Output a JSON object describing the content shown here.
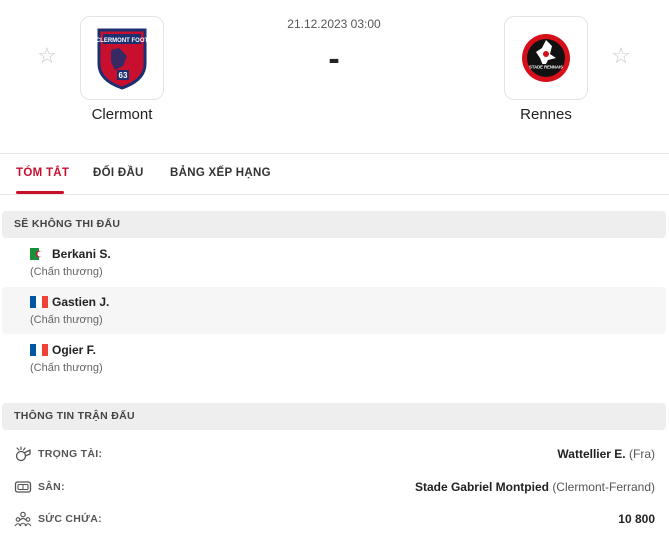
{
  "match": {
    "date": "21.12.2023 03:00",
    "score": "-",
    "home": {
      "name": "Clermont",
      "crest_text": "CLERMONT FOOT",
      "crest_number": "63"
    },
    "away": {
      "name": "Rennes",
      "crest_text": "STADE RENNAIS"
    }
  },
  "tabs": [
    {
      "label": "TÓM TẮT",
      "active": true
    },
    {
      "label": "ĐỐI ĐẦU",
      "active": false
    },
    {
      "label": "BẢNG XẾP HẠNG",
      "active": false
    }
  ],
  "missing": {
    "title": "SẼ KHÔNG THI ĐẤU",
    "players": [
      {
        "name": "Berkani S.",
        "reason": "(Chấn thương)",
        "flag": "algeria"
      },
      {
        "name": "Gastien J.",
        "reason": "(Chấn thương)",
        "flag": "france"
      },
      {
        "name": "Ogier F.",
        "reason": "(Chấn thương)",
        "flag": "france"
      }
    ]
  },
  "info": {
    "title": "THÔNG TIN TRẬN ĐẤU",
    "referee": {
      "label": "TRỌNG TÀI:",
      "value": "Wattellier E.",
      "extra": "(Fra)",
      "icon": "whistle-icon"
    },
    "venue": {
      "label": "SÂN:",
      "value": "Stade Gabriel Montpied",
      "extra": "(Clermont-Ferrand)",
      "icon": "stadium-icon"
    },
    "capacity": {
      "label": "SỨC CHỨA:",
      "value": "10 800",
      "icon": "crowd-icon"
    }
  },
  "colors": {
    "accent": "#c8102e",
    "clermont_red": "#c8102e",
    "clermont_blue": "#1c2f6e",
    "rennes_red": "#d5101b",
    "rennes_black": "#111111"
  }
}
